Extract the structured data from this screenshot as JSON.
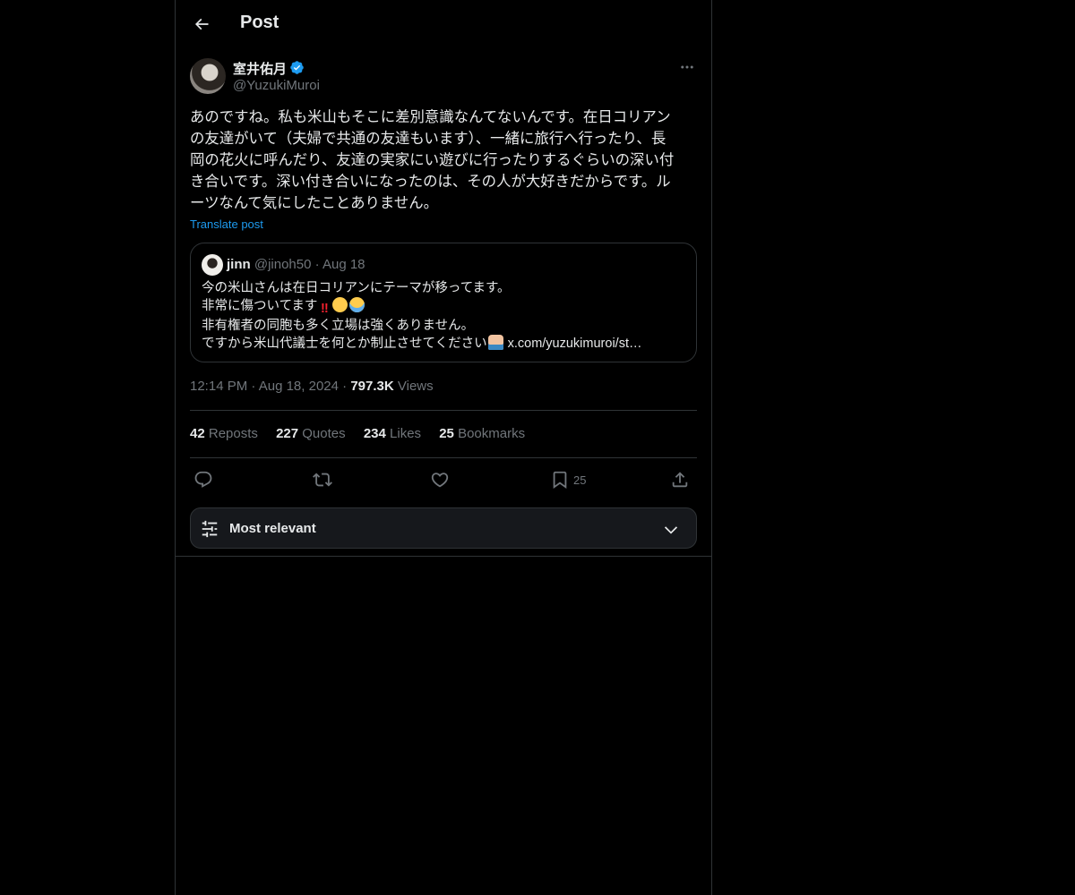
{
  "header": {
    "title": "Post",
    "back_icon": "arrow-left-icon"
  },
  "post": {
    "author": {
      "name": "室井佑月",
      "handle": "@YuzukiMuroi",
      "verified": true
    },
    "text_lines": [
      "あのですね。私も米山もそこに差別意識なんてないんです。在日コリアン",
      "の友達がいて（夫婦で共通の友達もいます）、一緒に旅行へ行ったり、長",
      "岡の花火に呼んだり、友達の実家にい遊びに行ったりするぐらいの深い付",
      "き合いです。深い付き合いになったのは、その人が大好きだからです。ル",
      "ーツなんて気にしたことありません。"
    ],
    "translate_label": "Translate post",
    "quote": {
      "name": "jinn",
      "handle": "@jinoh50",
      "separator": "·",
      "date": "Aug 18",
      "line1": "今の米山さんは在日コリアンにテーマが移ってます。",
      "line2_text": "非常に傷ついてます",
      "line2_bang": "‼",
      "line3": "非有権者の同胞も多く立場は強くありません。",
      "line4_text": "ですから米山代議士を何とか制止させてください",
      "line4_link": " x.com/yuzukimuroi/st…"
    },
    "meta": {
      "time": "12:14 PM",
      "sep": "·",
      "date": "Aug 18, 2024",
      "views_count": "797.3K",
      "views_label": "Views"
    },
    "stats": {
      "reposts_count": "42",
      "reposts_label": "Reposts",
      "quotes_count": "227",
      "quotes_label": "Quotes",
      "likes_count": "234",
      "likes_label": "Likes",
      "bookmarks_count": "25",
      "bookmarks_label": "Bookmarks"
    },
    "actions": {
      "reply_icon": "reply-icon",
      "repost_icon": "repost-icon",
      "like_icon": "heart-icon",
      "bookmark_icon": "bookmark-icon",
      "bookmark_count": "25",
      "share_icon": "share-icon"
    }
  },
  "sort": {
    "label": "Most relevant",
    "icon": "sliders-icon",
    "chevron": "chevron-down-icon"
  },
  "colors": {
    "accent": "#1d9bf0",
    "background": "#000000",
    "muted": "#71767b",
    "border": "#2f3336"
  }
}
